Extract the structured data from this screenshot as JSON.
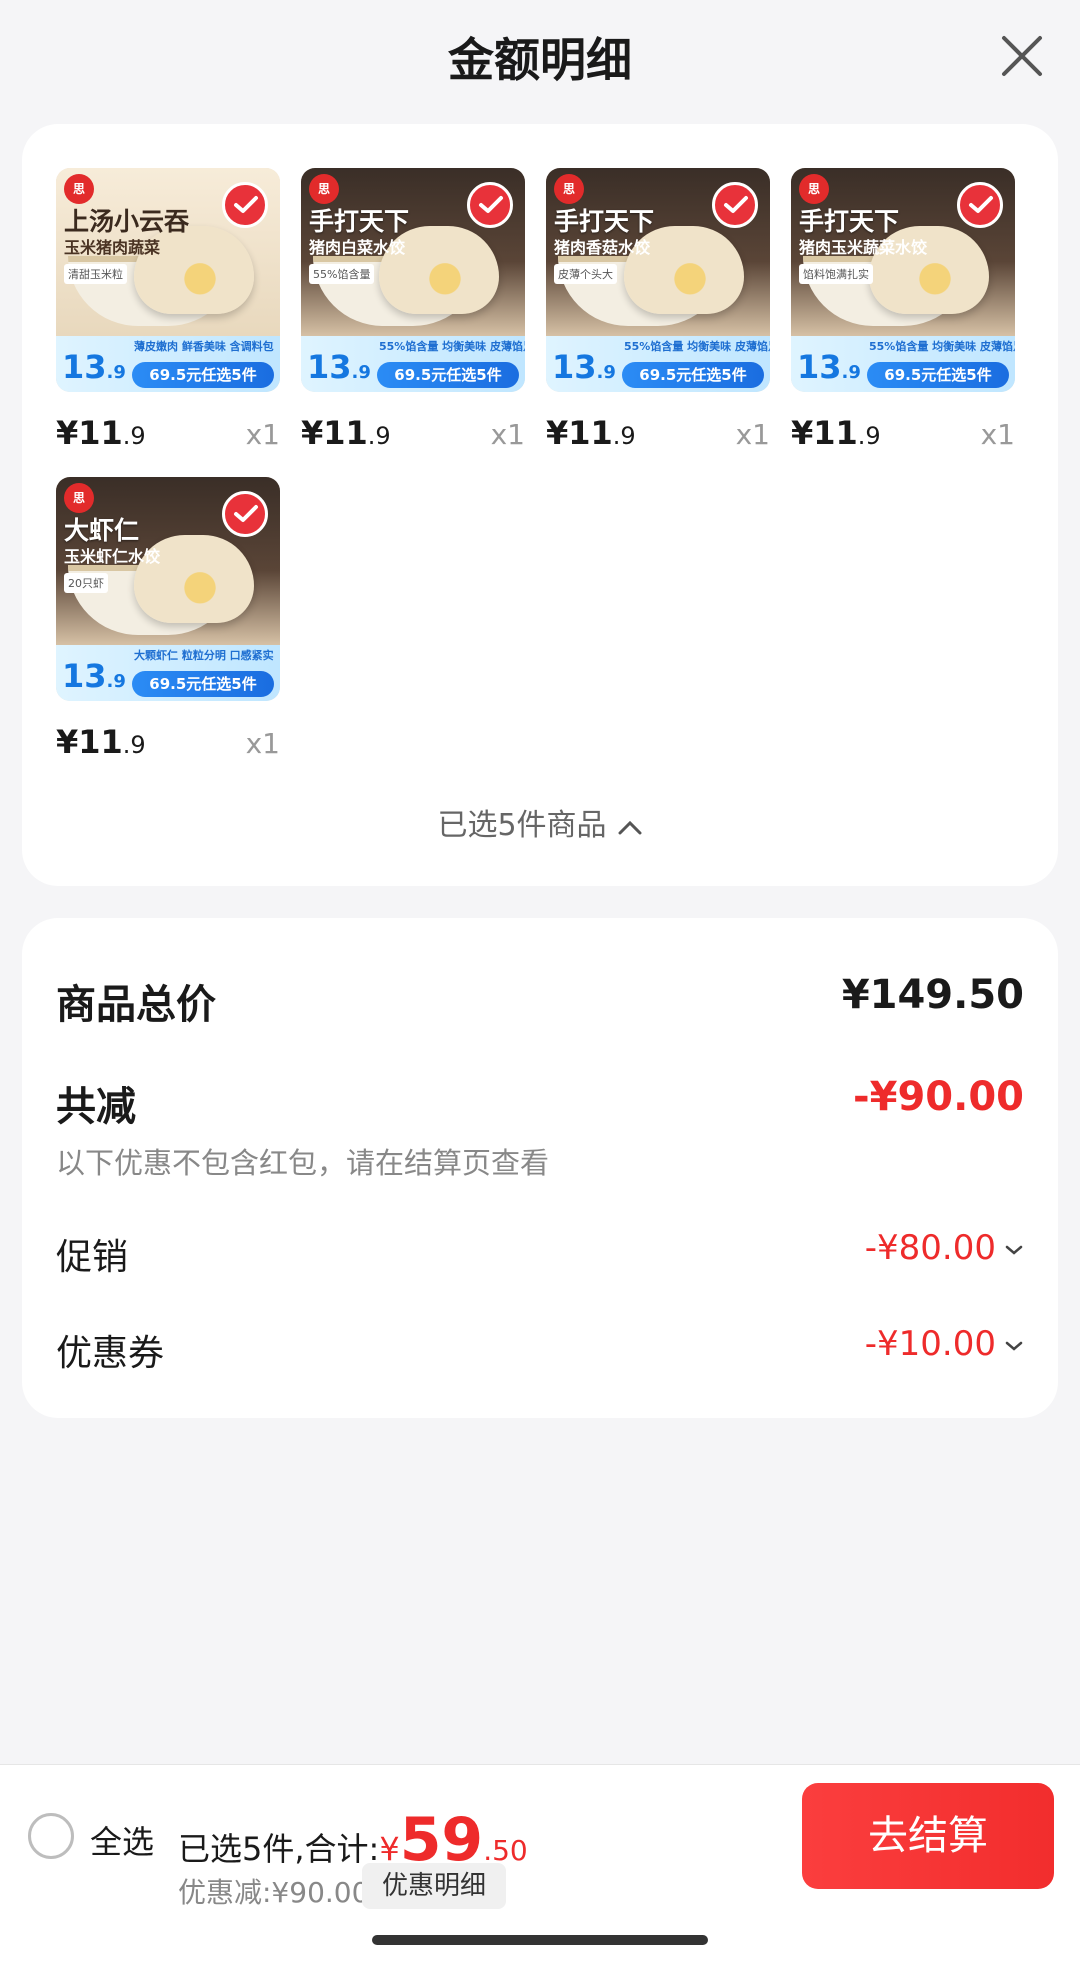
{
  "header": {
    "title": "金额明细",
    "close_icon": "close-icon"
  },
  "products": [
    {
      "title": "上汤小云吞",
      "subtitle": "玉米猪肉蔬菜",
      "tag": "清甜玉米粒",
      "features": "薄皮嫩肉 鲜香美味 含调料包",
      "est_price_int": "13",
      "est_price_frac": ".9",
      "promo": "69.5元任选5件",
      "price_int": "¥11",
      "price_frac": ".9",
      "qty": "x1",
      "style": "cream"
    },
    {
      "title": "手打天下",
      "subtitle": "猪肉白菜水饺",
      "tag": "55%馅含量",
      "features": "55%馅含量 均衡美味 皮薄馅足",
      "est_price_int": "13",
      "est_price_frac": ".9",
      "promo": "69.5元任选5件",
      "price_int": "¥11",
      "price_frac": ".9",
      "qty": "x1",
      "style": "dark"
    },
    {
      "title": "手打天下",
      "subtitle": "猪肉香菇水饺",
      "tag": "皮薄个头大",
      "features": "55%馅含量 均衡美味 皮薄馅足",
      "est_price_int": "13",
      "est_price_frac": ".9",
      "promo": "69.5元任选5件",
      "price_int": "¥11",
      "price_frac": ".9",
      "qty": "x1",
      "style": "dark"
    },
    {
      "title": "手打天下",
      "subtitle": "猪肉玉米蔬菜水饺",
      "tag": "馅料饱满扎实",
      "features": "55%馅含量 均衡美味 皮薄馅足",
      "est_price_int": "13",
      "est_price_frac": ".9",
      "promo": "69.5元任选5件",
      "price_int": "¥11",
      "price_frac": ".9",
      "qty": "x1",
      "style": "dark"
    },
    {
      "title": "大虾仁",
      "subtitle": "玉米虾仁水饺",
      "tag": "20只虾",
      "features": "大颗虾仁 粒粒分明 口感紧实",
      "est_price_int": "13",
      "est_price_frac": ".9",
      "promo": "69.5元任选5件",
      "price_int": "¥11",
      "price_frac": ".9",
      "qty": "x1",
      "style": "dark"
    }
  ],
  "selected_text": "已选5件商品",
  "summary": {
    "total_label": "商品总价",
    "total_value": "¥149.50",
    "reduce_label": "共减",
    "reduce_value": "-¥90.00",
    "note": "以下优惠不包含红包，请在结算页查看",
    "promo_label": "促销",
    "promo_value": "-¥80.00",
    "coupon_label": "优惠券",
    "coupon_value": "-¥10.00"
  },
  "bottom": {
    "select_all": "全选",
    "selected_summary": "已选5件,合计:",
    "currency": "¥",
    "total_int": "59",
    "total_frac": ".50",
    "discount": "优惠减:¥90.00",
    "detail_button": "优惠明细",
    "checkout": "去结算"
  },
  "colors": {
    "accent_red": "#ee2b2b",
    "checkout_red": "#f22d2d",
    "promo_blue": "#1a6de0"
  }
}
